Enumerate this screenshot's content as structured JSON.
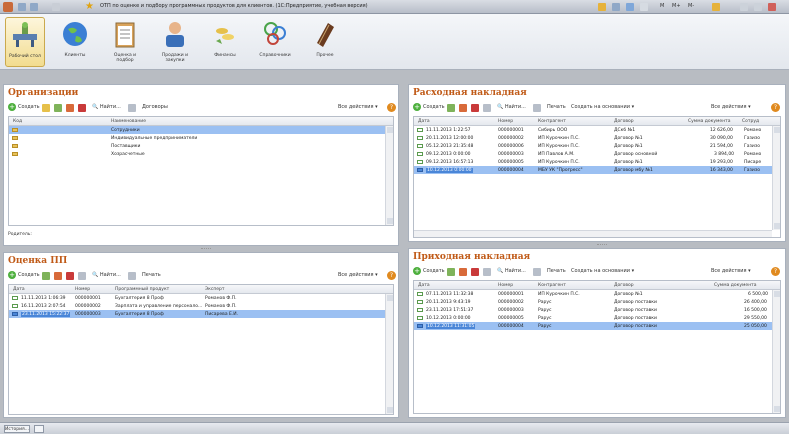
{
  "window": {
    "title": "ОТП по оценке и подбору программных продуктов для клиентов. (1С:Предприятие, учебная версия)",
    "right_labels": [
      "M",
      "M+",
      "M-"
    ]
  },
  "sections": [
    {
      "label": "Рабочий стол",
      "icon": "desktop-icon"
    },
    {
      "label": "Клиенты",
      "icon": "globe-icon"
    },
    {
      "label": "Оценка и подбор",
      "icon": "clipboard-icon"
    },
    {
      "label": "Продажи и закупки",
      "icon": "person-icon"
    },
    {
      "label": "Финансы",
      "icon": "coins-icon"
    },
    {
      "label": "Справочники",
      "icon": "people-icon"
    },
    {
      "label": "Прочее",
      "icon": "notebook-icon"
    }
  ],
  "org_panel": {
    "title": "Организации",
    "create": "Создать",
    "find": "Найти...",
    "contracts": "Договоры",
    "all_actions": "Все действия",
    "col_code": "Код",
    "col_name": "Наименование",
    "rows": [
      {
        "name": "Сотрудники"
      },
      {
        "name": "Индивидуальные предприниматели"
      },
      {
        "name": "Поставщики"
      },
      {
        "name": "Хозрасчетные"
      }
    ],
    "footer_label": "Родитель:"
  },
  "pp_panel": {
    "title": "Оценка ПП",
    "create": "Создать",
    "find": "Найти...",
    "print": "Печать",
    "all_actions": "Все действия",
    "cols": [
      "Дата",
      "Номер",
      "Программный продукт",
      "Эксперт"
    ],
    "rows": [
      {
        "date": "11.11.2013 1:06:39",
        "num": "000000001",
        "product": "Бухгалтерия 8 Проф",
        "expert": "Романов Ф.П."
      },
      {
        "date": "16.11.2013 2:07:54",
        "num": "000000002",
        "product": "Зарплата и управление персонало...",
        "expert": "Романов Ф.П."
      },
      {
        "date": "23.11.2013 15:22:37",
        "num": "000000003",
        "product": "Бухгалтерия 8 Проф",
        "expert": "Писарева Е.И."
      }
    ]
  },
  "out_panel": {
    "title": "Расходная накладная",
    "create": "Создать",
    "find": "Найти...",
    "print": "Печать",
    "create_based": "Создать на основании",
    "all_actions": "Все действия",
    "cols": [
      "Дата",
      "Номер",
      "Контрагент",
      "Договор",
      "Сумма документа",
      "Сотруд"
    ],
    "rows": [
      {
        "date": "11.11.2013 1:22:57",
        "num": "000000001",
        "contractor": "Сибирь ООО",
        "contract": "ДСкб №1",
        "sum": "12 626,00",
        "emp": "Романо"
      },
      {
        "date": "20.11.2013 12:00:00",
        "num": "000000002",
        "contractor": "ИП Курочкин П.С.",
        "contract": "Договор №1",
        "sum": "30 090,00",
        "emp": "Газизо"
      },
      {
        "date": "05.12.2013 21:35:48",
        "num": "000000006",
        "contractor": "ИП Курочкин П.С.",
        "contract": "Договор №1",
        "sum": "21 594,00",
        "emp": "Газизо"
      },
      {
        "date": "09.12.2013 0:00:00",
        "num": "000000003",
        "contractor": "ИП Павлов А.М.",
        "contract": "Договор основной",
        "sum": "3 894,00",
        "emp": "Романо"
      },
      {
        "date": "09.12.2013 16:57:13",
        "num": "000000005",
        "contractor": "ИП Курочкин П.С.",
        "contract": "Договор №1",
        "sum": "19 293,00",
        "emp": "Писаре"
      },
      {
        "date": "10.12.2013 0:00:00",
        "num": "000000004",
        "contractor": "МБУ УК \"Прогресс\"",
        "contract": "Договор мбу №1",
        "sum": "16 343,00",
        "emp": "Газизо"
      }
    ]
  },
  "in_panel": {
    "title": "Приходная накладная",
    "create": "Создать",
    "find": "Найти...",
    "print": "Печать",
    "create_based": "Создать на основании",
    "all_actions": "Все действия",
    "cols": [
      "Дата",
      "Номер",
      "Контрагент",
      "Договор",
      "Сумма документа"
    ],
    "rows": [
      {
        "date": "07.11.2013 11:32:38",
        "num": "000000001",
        "contractor": "ИП Курочкин П.С.",
        "contract": "Договор №1",
        "sum": "6 500,00"
      },
      {
        "date": "20.11.2013 9:43:19",
        "num": "000000002",
        "contractor": "Рарус",
        "contract": "Договор поставки",
        "sum": "26 400,00"
      },
      {
        "date": "23.11.2013 17:51:37",
        "num": "000000003",
        "contractor": "Рарус",
        "contract": "Договор поставки",
        "sum": "16 500,00"
      },
      {
        "date": "10.12.2013 0:00:00",
        "num": "000000005",
        "contractor": "Рарус",
        "contract": "Договор поставки",
        "sum": "29 550,00"
      },
      {
        "date": "10.12.2013 11:31:05",
        "num": "000000004",
        "contractor": "Рарус",
        "contract": "Договор поставки",
        "sum": "25 050,00"
      }
    ]
  },
  "bottom": {
    "history": "История..."
  }
}
